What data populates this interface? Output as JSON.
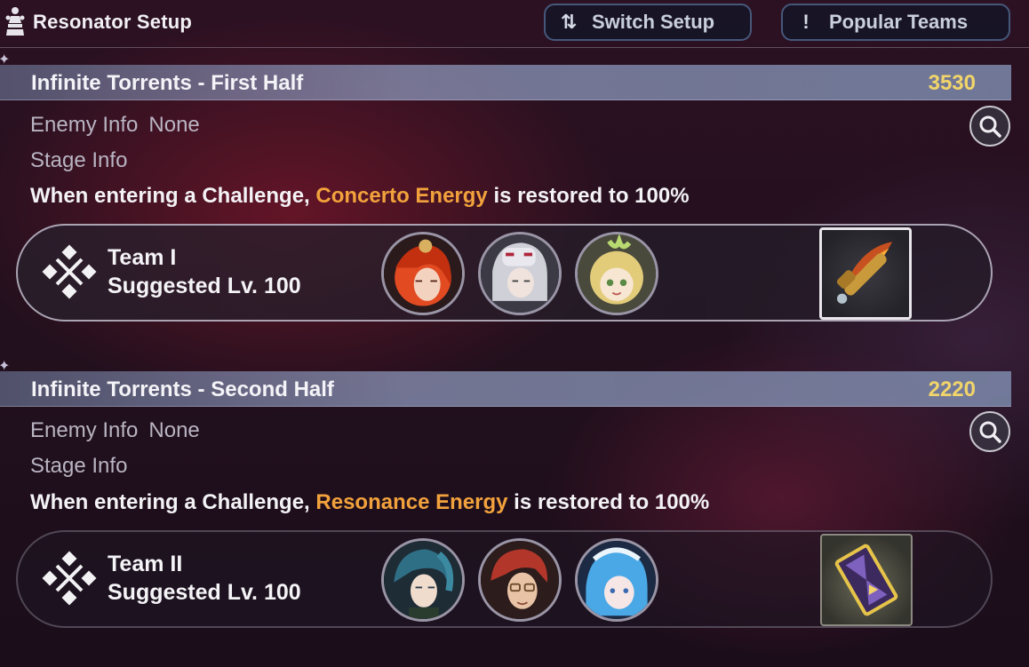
{
  "header": {
    "title": "Resonator Setup",
    "switch_label": "Switch Setup",
    "popular_label": "Popular Teams"
  },
  "stages": [
    {
      "title": "Infinite Torrents - First Half",
      "score": "3530",
      "enemy_label": "Enemy Info",
      "enemy_value": "None",
      "stage_info_label": "Stage Info",
      "desc_prefix": "When entering a Challenge,",
      "desc_highlight": "Concerto Energy",
      "desc_suffix": "is restored to 100%",
      "team": {
        "name": "Team I",
        "level": "Suggested Lv. 100",
        "members": [
          "resonator-1-portrait",
          "resonator-2-portrait",
          "resonator-3-portrait"
        ],
        "weapon_icon": "flaming-spyglass-icon"
      }
    },
    {
      "title": "Infinite Torrents - Second Half",
      "score": "2220",
      "enemy_label": "Enemy Info",
      "enemy_value": "None",
      "stage_info_label": "Stage Info",
      "desc_prefix": "When entering a Challenge,",
      "desc_highlight": "Resonance Energy",
      "desc_suffix": "is restored to 100%",
      "team": {
        "name": "Team II",
        "level": "Suggested Lv. 100",
        "members": [
          "resonator-4-portrait",
          "resonator-5-portrait",
          "resonator-6-portrait"
        ],
        "weapon_icon": "hourglass-frame-icon"
      }
    }
  ],
  "colors": {
    "score": "#f1d56a",
    "highlight": "#f2a23c",
    "header_band": "#8c96b9"
  }
}
